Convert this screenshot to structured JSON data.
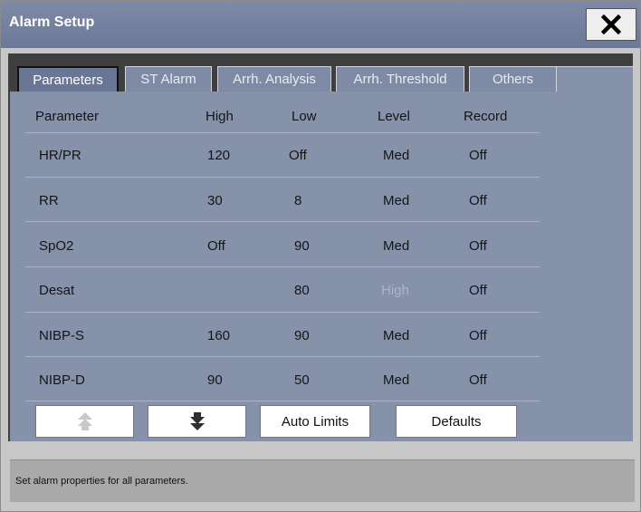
{
  "window": {
    "title": "Alarm Setup",
    "close_icon": "close-icon"
  },
  "tabs": [
    {
      "label": "Parameters",
      "active": true
    },
    {
      "label": "ST Alarm",
      "active": false
    },
    {
      "label": "Arrh. Analysis",
      "active": false
    },
    {
      "label": "Arrh. Threshold",
      "active": false
    },
    {
      "label": "Others",
      "active": false
    }
  ],
  "table": {
    "headers": [
      "Parameter",
      "High",
      "Low",
      "Level",
      "Record"
    ],
    "rows": [
      {
        "parameter": "HR/PR",
        "high": "120",
        "low": "Off",
        "level": "Med",
        "record": "Off"
      },
      {
        "parameter": "RR",
        "high": "30",
        "low": "8",
        "level": "Med",
        "record": "Off"
      },
      {
        "parameter": "SpO2",
        "high": "Off",
        "low": "90",
        "level": "Med",
        "record": "Off"
      },
      {
        "parameter": "Desat",
        "high": "",
        "low": "80",
        "level": "High",
        "record": "Off",
        "level_disabled": true
      },
      {
        "parameter": "NIBP-S",
        "high": "160",
        "low": "90",
        "level": "Med",
        "record": "Off"
      },
      {
        "parameter": "NIBP-D",
        "high": "90",
        "low": "50",
        "level": "Med",
        "record": "Off"
      }
    ]
  },
  "buttons": {
    "page_up_icon": "arrow-up-icon",
    "page_down_icon": "arrow-down-icon",
    "auto_limits": "Auto Limits",
    "defaults": "Defaults"
  },
  "status": {
    "message": "Set alarm properties for all parameters."
  },
  "colors": {
    "titlebar": "#6c7896",
    "content": "#8691aa",
    "tab_active": "#6a7696",
    "disabled_text": "#aeb5c5"
  }
}
